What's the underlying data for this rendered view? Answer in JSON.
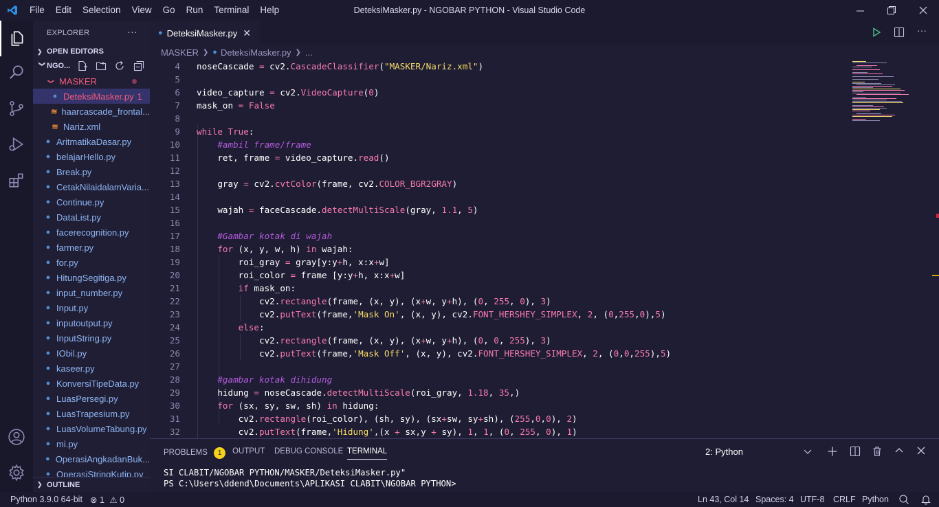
{
  "window": {
    "title": "DeteksiMasker.py - NGOBAR PYTHON - Visual Studio Code",
    "menu": [
      "File",
      "Edit",
      "Selection",
      "View",
      "Go",
      "Run",
      "Terminal",
      "Help"
    ]
  },
  "sidebar": {
    "header": "EXPLORER",
    "open_editors": "OPEN EDITORS",
    "workspace": "NGO...",
    "outline": "OUTLINE",
    "folder": "MASKER",
    "folder_files": [
      {
        "name": "DeteksiMasker.py",
        "badge": "1",
        "icon": "python-file-icon"
      },
      {
        "name": "haarcascade_frontal...",
        "icon": "rss-xml-icon"
      },
      {
        "name": "Nariz.xml",
        "icon": "rss-xml-icon"
      }
    ],
    "files": [
      "AritmatikaDasar.py",
      "belajarHello.py",
      "Break.py",
      "CetakNilaidalamVaria...",
      "Continue.py",
      "DataList.py",
      "facerecognition.py",
      "farmer.py",
      "for.py",
      "HitungSegitiga.py",
      "input_number.py",
      "Input.py",
      "inputoutput.py",
      "InputString.py",
      "IObil.py",
      "kaseer.py",
      "KonversiTipeData.py",
      "LuasPersegi.py",
      "LuasTrapesium.py",
      "LuasVolumeTabung.py",
      "mi.py",
      "OperasiAngkadanBuk...",
      "OperasiStringKutip.py"
    ]
  },
  "tab": {
    "label": "DeteksiMasker.py"
  },
  "breadcrumb": {
    "folder": "MASKER",
    "file": "DeteksiMasker.py",
    "rest": "..."
  },
  "code": [
    {
      "n": "4",
      "html": "noseCascade <span class=\"op\">=</span> cv2.<span class=\"fn\">CascadeClassifier</span>(<span class=\"str\">\"MASKER/Nariz.xml\"</span>)"
    },
    {
      "n": "5",
      "html": ""
    },
    {
      "n": "6",
      "html": "video_capture <span class=\"op\">=</span> cv2.<span class=\"fn\">VideoCapture</span>(<span class=\"num\">0</span>)"
    },
    {
      "n": "7",
      "html": "mask_on <span class=\"op\">=</span> <span class=\"bool\">False</span>"
    },
    {
      "n": "8",
      "html": ""
    },
    {
      "n": "9",
      "html": "<span class=\"kw\">while</span> <span class=\"bool\">True</span>:"
    },
    {
      "n": "10",
      "html": "    <span class=\"cm\">#ambil frame/frame</span>"
    },
    {
      "n": "11",
      "html": "    ret, frame <span class=\"op\">=</span> video_capture.<span class=\"fn\">read</span>()"
    },
    {
      "n": "12",
      "html": ""
    },
    {
      "n": "13",
      "html": "    gray <span class=\"op\">=</span> cv2.<span class=\"fn\">cvtColor</span>(frame, cv2.<span class=\"attr\">COLOR_BGR2GRAY</span>)"
    },
    {
      "n": "14",
      "html": ""
    },
    {
      "n": "15",
      "html": "    wajah <span class=\"op\">=</span> faceCascade.<span class=\"fn\">detectMultiScale</span>(gray, <span class=\"num\">1.1</span>, <span class=\"num\">5</span>)"
    },
    {
      "n": "16",
      "html": ""
    },
    {
      "n": "17",
      "html": "    <span class=\"cm\">#Gambar kotak di wajah</span>"
    },
    {
      "n": "18",
      "html": "    <span class=\"kw\">for</span> (x, y, w, h) <span class=\"kw\">in</span> wajah:"
    },
    {
      "n": "19",
      "html": "        roi_gray <span class=\"op\">=</span> gray[y:y<span class=\"op\">+</span>h, x:x<span class=\"op\">+</span>w]"
    },
    {
      "n": "20",
      "html": "        roi_color <span class=\"op\">=</span> frame [y:y<span class=\"op\">+</span>h, x:x<span class=\"op\">+</span>w]"
    },
    {
      "n": "21",
      "html": "        <span class=\"kw\">if</span> mask_on:"
    },
    {
      "n": "22",
      "html": "            cv2.<span class=\"fn\">rectangle</span>(frame, (x, y), (x<span class=\"op\">+</span>w, y<span class=\"op\">+</span>h), (<span class=\"num\">0</span>, <span class=\"num\">255</span>, <span class=\"num\">0</span>), <span class=\"num\">3</span>)"
    },
    {
      "n": "23",
      "html": "            cv2.<span class=\"fn\">putText</span>(frame,<span class=\"str\">'Mask On'</span>, (x, y), cv2.<span class=\"attr\">FONT_HERSHEY_SIMPLEX</span>, <span class=\"num\">2</span>, (<span class=\"num\">0</span>,<span class=\"num\">255</span>,<span class=\"num\">0</span>),<span class=\"num\">5</span>)"
    },
    {
      "n": "24",
      "html": "        <span class=\"kw\">else</span>:"
    },
    {
      "n": "25",
      "html": "            cv2.<span class=\"fn\">rectangle</span>(frame, (x, y), (x<span class=\"op\">+</span>w, y<span class=\"op\">+</span>h), (<span class=\"num\">0</span>, <span class=\"num\">0</span>, <span class=\"num\">255</span>), <span class=\"num\">3</span>)"
    },
    {
      "n": "26",
      "html": "            cv2.<span class=\"fn\">putText</span>(frame,<span class=\"str\">'Mask Off'</span>, (x, y), cv2.<span class=\"attr\">FONT_HERSHEY_SIMPLEX</span>, <span class=\"num\">2</span>, (<span class=\"num\">0</span>,<span class=\"num\">0</span>,<span class=\"num\">255</span>),<span class=\"num\">5</span>)"
    },
    {
      "n": "27",
      "html": ""
    },
    {
      "n": "28",
      "html": "    <span class=\"cm\">#gambar kotak dihidung</span>"
    },
    {
      "n": "29",
      "html": "    hidung <span class=\"op\">=</span> noseCascade.<span class=\"fn\">detectMultiScale</span>(roi_gray, <span class=\"num\">1.18</span>, <span class=\"num\">35</span>,)"
    },
    {
      "n": "30",
      "html": "    <span class=\"kw\">for</span> (sx, sy, sw, sh) <span class=\"kw\">in</span> hidung:"
    },
    {
      "n": "31",
      "html": "        cv2.<span class=\"fn\">rectangle</span>(roi_color), (sh, sy), (sx<span class=\"op\">+</span>sw, sy<span class=\"op\">+</span>sh), (<span class=\"num\">255</span>,<span class=\"num\">0</span>,<span class=\"num\">0</span>), <span class=\"num\">2</span>)"
    },
    {
      "n": "32",
      "html": "        cv2.<span class=\"fn\">putText</span>(frame,<span class=\"str\">'Hidung'</span>,(x <span class=\"op\">+</span> sx,y <span class=\"op\">+</span> sy), <span class=\"num\">1</span>, <span class=\"num\">1</span>, (<span class=\"num\">0</span>, <span class=\"num\">255</span>, <span class=\"num\">0</span>), <span class=\"num\">1</span>)"
    }
  ],
  "panel": {
    "tabs": [
      "PROBLEMS",
      "OUTPUT",
      "DEBUG CONSOLE",
      "TERMINAL"
    ],
    "problems_count": "1",
    "terminal_select": "2: Python",
    "terminal_lines": [
      "SI CLABIT/NGOBAR PYTHON/MASKER/DeteksiMasker.py\"",
      "PS C:\\Users\\ddend\\Documents\\APLIKASI CLABIT\\NGOBAR PYTHON>"
    ]
  },
  "status": {
    "interpreter": "Python 3.9.0 64-bit",
    "errors": "1",
    "warnings": "0",
    "position": "Ln 43, Col 14",
    "spaces": "Spaces: 4",
    "encoding": "UTF-8",
    "eol": "CRLF",
    "language": "Python"
  },
  "colors": {
    "accent": "#f97bb0",
    "string": "#f8dc6b",
    "comment": "#b35bdb",
    "badge": "#f5d21c"
  }
}
